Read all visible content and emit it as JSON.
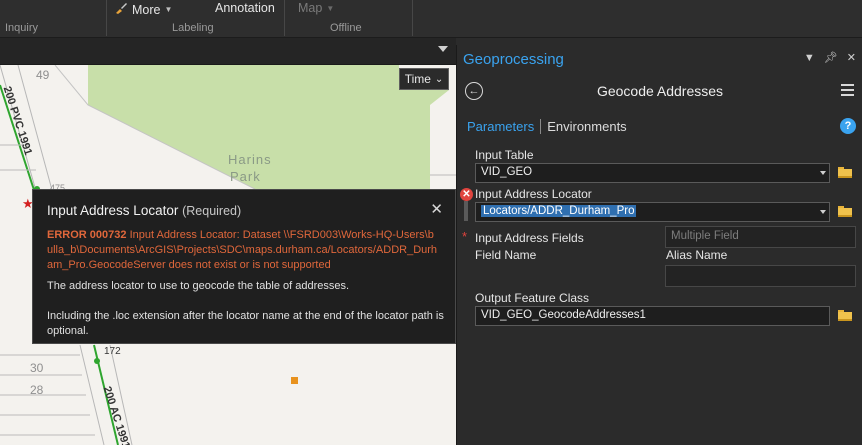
{
  "ribbon": {
    "groups": [
      "Inquiry",
      "Labeling",
      "Offline"
    ],
    "commands": {
      "more_label": "More",
      "annotation_label": "Annotation",
      "map_label": "Map"
    }
  },
  "map": {
    "time_label": "Time",
    "park_label_1": "Harins",
    "park_label_2": "Park",
    "parcel_numbers": [
      "49",
      "475",
      "172",
      "30",
      "28"
    ],
    "road_label_top": "200 PVC 1991",
    "road_label_bottom": "200 AC 1991"
  },
  "tooltip": {
    "title": "Input Address Locator",
    "required": "(Required)",
    "error_code": "ERROR 000732",
    "error_text": "Input Address Locator: Dataset \\\\FSRD003\\Works-HQ-Users\\bulla_b\\Documents\\ArcGIS\\Projects\\SDC\\maps.durham.ca/Locators/ADDR_Durham_Pro.GeocodeServer does not exist or is not supported",
    "description": "The address locator to use to geocode the table of addresses.",
    "note": "Including the .loc extension after the locator name at the end of the locator path is optional."
  },
  "geoprocessing": {
    "pane_title": "Geoprocessing",
    "tool_title": "Geocode Addresses",
    "tabs": {
      "parameters": "Parameters",
      "environments": "Environments"
    },
    "help": "?",
    "input_table": {
      "label": "Input Table",
      "value": "VID_GEO"
    },
    "input_locator": {
      "label": "Input Address Locator",
      "value": "Locators/ADDR_Durham_Pro"
    },
    "address_fields": {
      "label": "Input Address Fields",
      "placeholder": "Multiple Field"
    },
    "field_name_header": "Field Name",
    "alias_name_header": "Alias Name",
    "output": {
      "label": "Output Feature Class",
      "value": "VID_GEO_GeocodeAddresses1"
    }
  },
  "colors": {
    "accent": "#3aa3ef",
    "error": "#e0673b",
    "park": "#c8dfa9"
  }
}
